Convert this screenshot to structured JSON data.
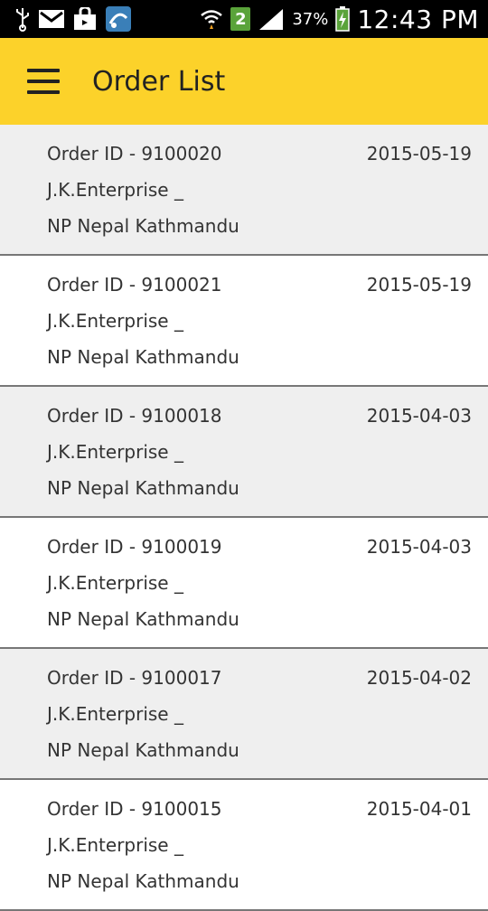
{
  "status_bar": {
    "battery": "37%",
    "notification_badge": "2",
    "time": "12:43 PM"
  },
  "app_bar": {
    "title": "Order List"
  },
  "orders": [
    {
      "order_id": "Order ID - 9100020",
      "date": "2015-05-19",
      "company": "J.K.Enterprise _",
      "location": "NP Nepal Kathmandu"
    },
    {
      "order_id": "Order ID - 9100021",
      "date": "2015-05-19",
      "company": "J.K.Enterprise _",
      "location": "NP Nepal Kathmandu"
    },
    {
      "order_id": "Order ID - 9100018",
      "date": "2015-04-03",
      "company": "J.K.Enterprise _",
      "location": "NP Nepal Kathmandu"
    },
    {
      "order_id": "Order ID - 9100019",
      "date": "2015-04-03",
      "company": "J.K.Enterprise _",
      "location": "NP Nepal Kathmandu"
    },
    {
      "order_id": "Order ID - 9100017",
      "date": "2015-04-02",
      "company": "J.K.Enterprise _",
      "location": "NP Nepal Kathmandu"
    },
    {
      "order_id": "Order ID - 9100015",
      "date": "2015-04-01",
      "company": "J.K.Enterprise _",
      "location": "NP Nepal Kathmandu"
    }
  ],
  "colors": {
    "app_bar": "#fcd22a",
    "row_alt": "#efefef",
    "divider": "#777777"
  }
}
